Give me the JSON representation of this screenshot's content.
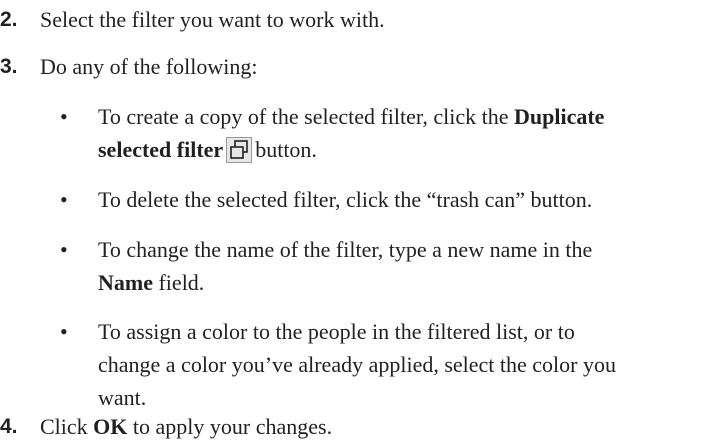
{
  "steps": [
    {
      "number": "2.",
      "text": "Select the filter you want to work with."
    },
    {
      "number": "3.",
      "text": "Do any of the following:"
    },
    {
      "number": "4.",
      "pre": "Click ",
      "bold": "OK",
      "post": " to apply your changes."
    }
  ],
  "bullets": {
    "symbol": "•",
    "duplicate": {
      "line1_pre": "To create a copy of the selected filter, click the ",
      "line1_bold": "Duplicate",
      "line2_bold": "selected filter",
      "line2_post": "button.",
      "icon": "duplicate-filter-icon"
    },
    "delete": {
      "text": "To delete the selected filter, click the “trash can” button."
    },
    "rename": {
      "line1": "To change the name of the filter, type a new name in the",
      "line2_bold": "Name",
      "line2_post": " field."
    },
    "color": {
      "line1": "To assign a color to the people in the filtered list, or to",
      "line2": "change a color you’ve already applied, select the color you",
      "line3": "want."
    }
  }
}
